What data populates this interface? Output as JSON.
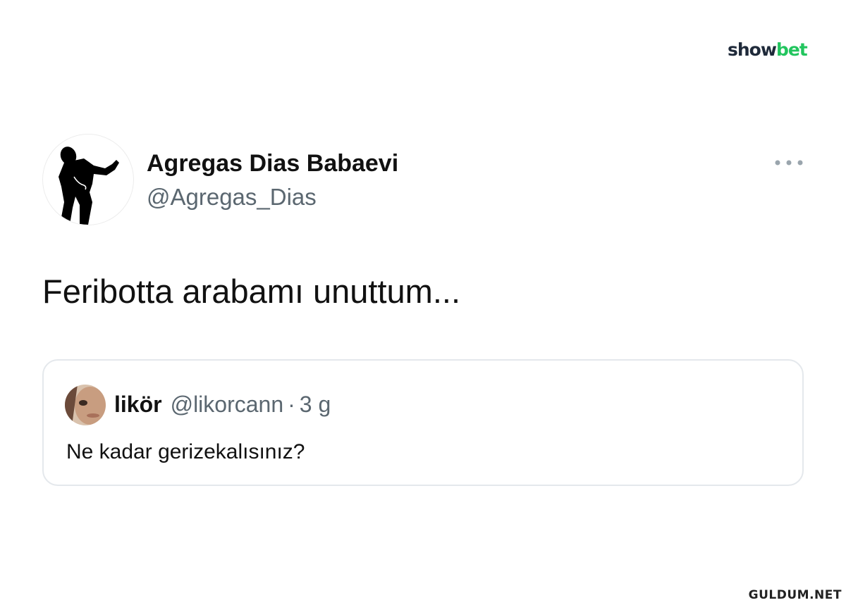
{
  "brand": {
    "part1": "show",
    "part2": "bet",
    "accent_color": "#22c55e"
  },
  "tweet": {
    "author_name": "Agregas Dias Babaevi",
    "author_handle": "@Agregas_Dias",
    "text": "Feribotta arabamı unuttum...",
    "avatar_icon": "silhouette-avatar-icon",
    "more_icon": "more-options-icon"
  },
  "quoted_tweet": {
    "name": "likör",
    "handle": "@likorcann",
    "separator": "·",
    "time": "3 g",
    "text": "Ne kadar gerizekalısınız?"
  },
  "watermark": "GULDUM.NET",
  "colors": {
    "text_primary": "#111111",
    "text_secondary": "#5b6770",
    "card_border": "#e4e8ec"
  }
}
